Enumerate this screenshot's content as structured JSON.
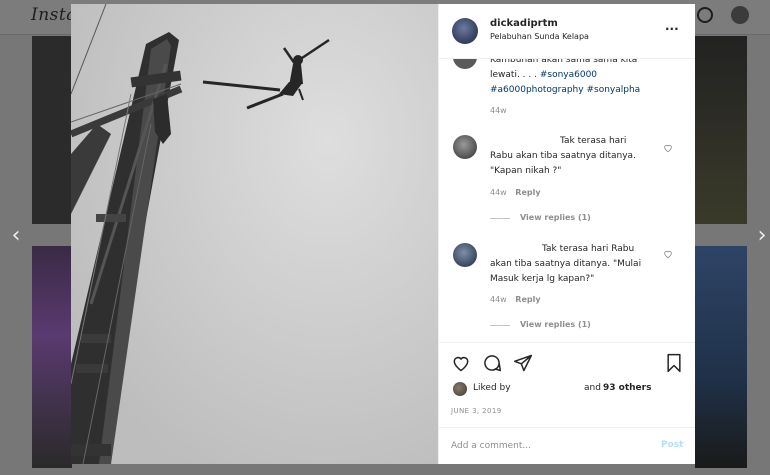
{
  "background": {
    "logo": "Insta"
  },
  "post": {
    "username": "dickadiprtm",
    "location": "Pelabuhan Sunda Kelapa",
    "more_icon": "···",
    "caption_partial_line1": "Kambuhan akan sama sama kita",
    "caption_partial_line2": "lewati. . . .",
    "tag_1": "#sonya6000",
    "tag_2": "#a6000photography",
    "tag_3": "#sonyalpha",
    "caption_time": "44w"
  },
  "comments": [
    {
      "line1": "Tak terasa hari",
      "line2": "Rabu akan tiba saatnya ditanya.",
      "line3": "\"Kapan nikah ?\"",
      "time": "44w",
      "reply_label": "Reply",
      "view_replies": "View replies (1)"
    },
    {
      "line1": "Tak terasa hari Rabu",
      "line2": "akan tiba saatnya ditanya. \"Mulai",
      "line3": "Masuk kerja lg kapan?\"",
      "time": "44w",
      "reply_label": "Reply",
      "view_replies": "View replies (1)"
    }
  ],
  "likes": {
    "prefix": "Liked by",
    "and": "and",
    "count": "93 others"
  },
  "date": "JUNE 3, 2019",
  "add_comment": {
    "placeholder": "Add a comment...",
    "post_label": "Post"
  },
  "nav": {
    "prev": "‹",
    "next": "›"
  },
  "colors": {
    "link": "#00376b",
    "post_disabled": "#b2dffc",
    "secondary_text": "#8e8e8e"
  }
}
